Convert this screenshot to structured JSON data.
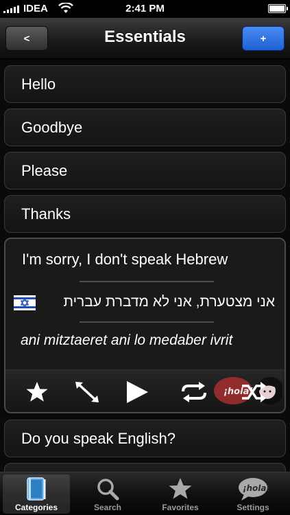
{
  "status_bar": {
    "carrier": "IDEA",
    "time": "2:41 PM"
  },
  "nav": {
    "title": "Essentials",
    "back_label": "<",
    "add_label": "+"
  },
  "list": {
    "items": [
      {
        "label": "Hello"
      },
      {
        "label": "Goodbye"
      },
      {
        "label": "Please"
      },
      {
        "label": "Thanks"
      }
    ],
    "expanded": {
      "phrase": "I'm sorry, I don't speak Hebrew",
      "translation": "אני מצטערת, אני לא מדברת עברית",
      "transliteration": "ani mitztaeret ani lo medaber ivrit",
      "flag": "israel-flag",
      "controls": [
        "star-icon",
        "resize-icon",
        "play-icon",
        "repeat-icon",
        "shuffle-icon"
      ],
      "sticker": "hola-logo"
    },
    "items_after": [
      {
        "label": "Do you speak English?"
      }
    ]
  },
  "tab_bar": {
    "tabs": [
      {
        "label": "Categories",
        "icon": "book-icon",
        "active": true
      },
      {
        "label": "Search",
        "icon": "magnifier-icon",
        "active": false
      },
      {
        "label": "Favorites",
        "icon": "star-icon",
        "active": false
      },
      {
        "label": "Settings",
        "icon": "hola-icon",
        "active": false
      }
    ]
  },
  "colors": {
    "accent_blue": "#2f6fe6",
    "background": "#0a0a0a",
    "cell_border": "#3a3a3a"
  }
}
